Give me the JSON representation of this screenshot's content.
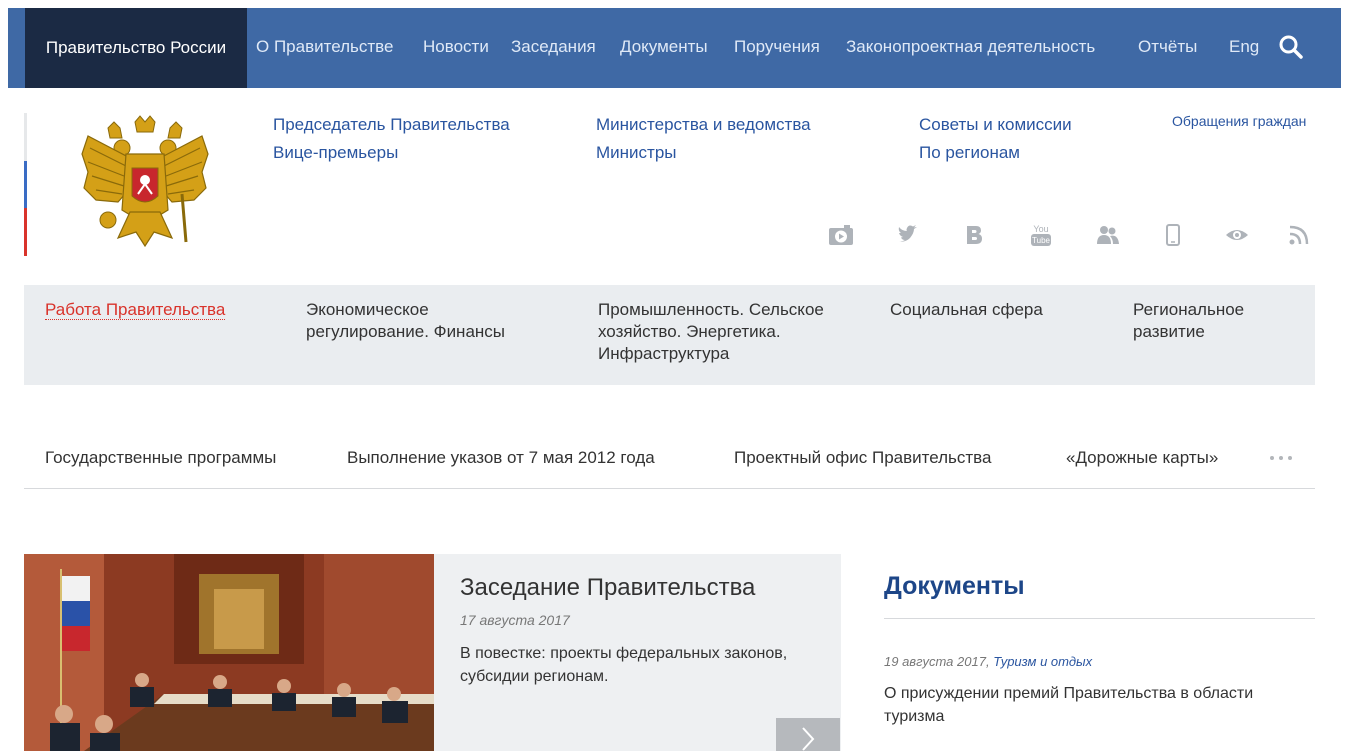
{
  "topnav": {
    "home": "Правительство России",
    "items": [
      "О Правительстве",
      "Новости",
      "Заседания",
      "Документы",
      "Поручения",
      "Законопроектная деятельность",
      "Отчёты",
      "Eng"
    ],
    "bg_color": "#3f69a5",
    "home_bg_color": "#1b2a44",
    "search_icon": "search-icon"
  },
  "header": {
    "links": [
      "Председатель Правительства",
      "Вице-премьеры",
      "Министерства и ведомства",
      "Министры",
      "Советы и комиссии",
      "По регионам"
    ],
    "appeals": "Обращения граждан",
    "social_icons": [
      "photo-video-icon",
      "twitter-icon",
      "vk-icon",
      "youtube-icon",
      "community-icon",
      "mobile-icon",
      "eye-icon",
      "rss-icon"
    ]
  },
  "categories": [
    "Работа Правительства",
    "Экономическое регулирование. Финансы",
    "Промышленность. Сельское хозяйство. Энергетика. Инфраструктура",
    "Социальная сфера",
    "Региональное развитие"
  ],
  "subnav": {
    "items": [
      "Государственные программы",
      "Выполнение указов от 7 мая 2012 года",
      "Проектный офис Правительства",
      "«Дорожные карты»"
    ],
    "more_icon": "more-dots-icon"
  },
  "feature": {
    "title": "Заседание Правительства",
    "date": "17 августа 2017",
    "text": "В повестке: проекты федеральных законов, субсидии регионам."
  },
  "documents": {
    "heading": "Документы",
    "date": "19 августа 2017,",
    "tag": "Туризм и отдых",
    "title": "О присуждении премий Правительства в области туризма"
  },
  "colors": {
    "accent_red": "#d9332b",
    "link_blue": "#2a55a0",
    "heading_blue": "#1d4688"
  }
}
